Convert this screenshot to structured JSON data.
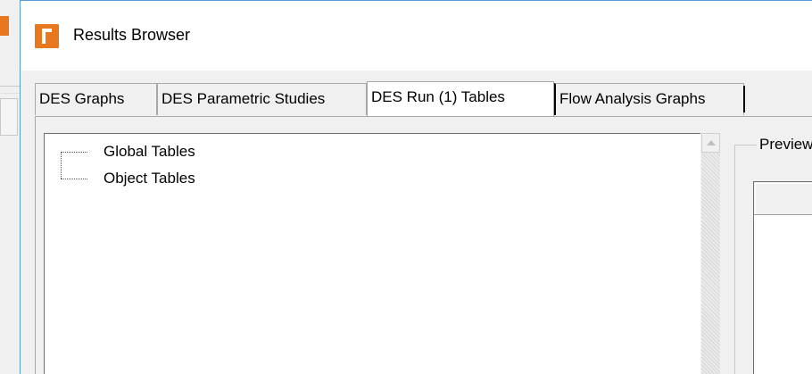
{
  "window": {
    "title": "Results Browser",
    "icon": "app-logo-icon",
    "accent_color": "#e8771e"
  },
  "tabs": [
    {
      "label": "DES Graphs",
      "active": false
    },
    {
      "label": "DES Parametric Studies",
      "active": false
    },
    {
      "label": "DES Run (1) Tables",
      "active": true
    },
    {
      "label": "Flow Analysis Graphs",
      "active": false
    }
  ],
  "tree": {
    "items": [
      {
        "label": "Global Tables"
      },
      {
        "label": "Object Tables"
      }
    ]
  },
  "preview": {
    "label": "Preview"
  }
}
